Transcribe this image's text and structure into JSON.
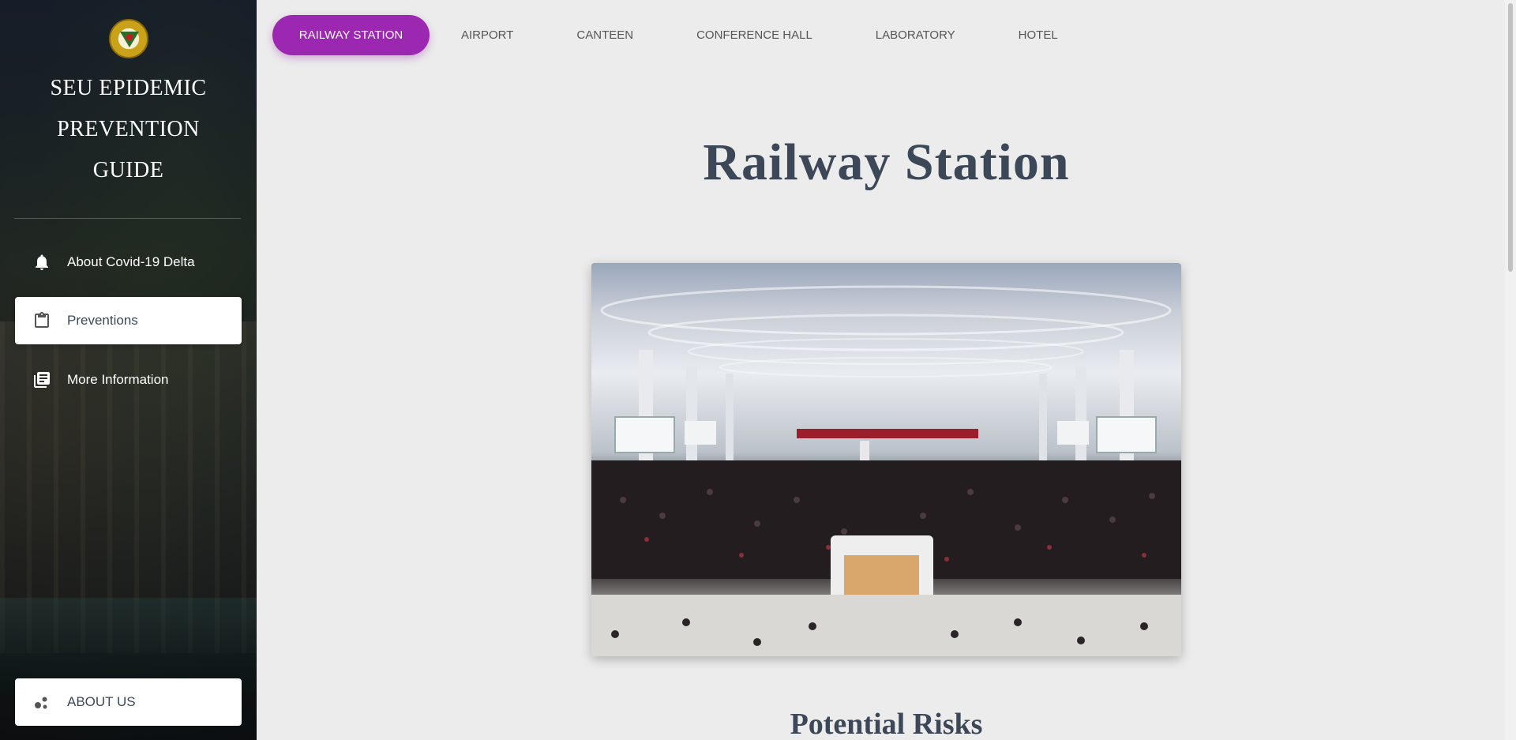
{
  "sidebar": {
    "brand_lines": [
      "SEU EPIDEMIC",
      "PREVENTION",
      "GUIDE"
    ],
    "items": [
      {
        "label": "About Covid-19 Delta",
        "icon": "bell-icon",
        "active": false
      },
      {
        "label": "Preventions",
        "icon": "clipboard-icon",
        "active": true
      },
      {
        "label": "More Information",
        "icon": "library-books-icon",
        "active": false
      }
    ],
    "about_label": "ABOUT US"
  },
  "tabs": [
    {
      "label": "RAILWAY STATION",
      "active": true
    },
    {
      "label": "AIRPORT",
      "active": false
    },
    {
      "label": "CANTEEN",
      "active": false
    },
    {
      "label": "CONFERENCE HALL",
      "active": false
    },
    {
      "label": "LABORATORY",
      "active": false
    },
    {
      "label": "HOTEL",
      "active": false
    }
  ],
  "main": {
    "title": "Railway Station",
    "section_title": "Potential Risks"
  },
  "colors": {
    "accent": "#9c27b0",
    "text_dark": "#3c4858",
    "page_bg": "#ececec"
  }
}
